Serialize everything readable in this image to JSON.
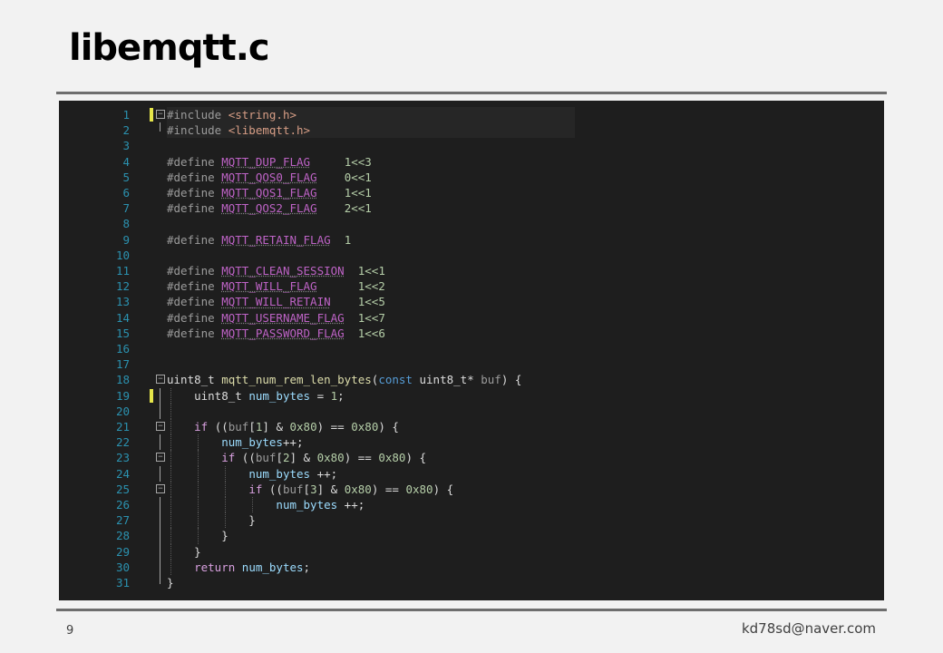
{
  "slide": {
    "title": "libemqtt.c",
    "page_number": "9",
    "email": "kd78sd@naver.com"
  },
  "editor": {
    "lines": [
      {
        "n": "1",
        "mark": "yellow",
        "fold": "minus",
        "hl": true,
        "tokens": [
          [
            "pp",
            "#include "
          ],
          [
            "str",
            "<string.h>"
          ]
        ]
      },
      {
        "n": "2",
        "mark": "",
        "fold": "end",
        "hl": true,
        "tokens": [
          [
            "pp",
            "#include "
          ],
          [
            "str",
            "<libemqtt.h>"
          ]
        ]
      },
      {
        "n": "3",
        "tokens": []
      },
      {
        "n": "4",
        "tokens": [
          [
            "pp",
            "#define "
          ],
          [
            "mac",
            "MQTT_DUP_FLAG"
          ],
          [
            "typ",
            "     "
          ],
          [
            "num",
            "1<<3"
          ]
        ]
      },
      {
        "n": "5",
        "tokens": [
          [
            "pp",
            "#define "
          ],
          [
            "mac",
            "MQTT_QOS0_FLAG"
          ],
          [
            "typ",
            "    "
          ],
          [
            "num",
            "0<<1"
          ]
        ]
      },
      {
        "n": "6",
        "tokens": [
          [
            "pp",
            "#define "
          ],
          [
            "mac",
            "MQTT_QOS1_FLAG"
          ],
          [
            "typ",
            "    "
          ],
          [
            "num",
            "1<<1"
          ]
        ]
      },
      {
        "n": "7",
        "tokens": [
          [
            "pp",
            "#define "
          ],
          [
            "mac",
            "MQTT_QOS2_FLAG"
          ],
          [
            "typ",
            "    "
          ],
          [
            "num",
            "2<<1"
          ]
        ]
      },
      {
        "n": "8",
        "tokens": []
      },
      {
        "n": "9",
        "tokens": [
          [
            "pp",
            "#define "
          ],
          [
            "mac",
            "MQTT_RETAIN_FLAG"
          ],
          [
            "typ",
            "  "
          ],
          [
            "num",
            "1"
          ]
        ]
      },
      {
        "n": "10",
        "tokens": []
      },
      {
        "n": "11",
        "tokens": [
          [
            "pp",
            "#define "
          ],
          [
            "mac",
            "MQTT_CLEAN_SESSION"
          ],
          [
            "typ",
            "  "
          ],
          [
            "num",
            "1<<1"
          ]
        ]
      },
      {
        "n": "12",
        "tokens": [
          [
            "pp",
            "#define "
          ],
          [
            "mac",
            "MQTT_WILL_FLAG"
          ],
          [
            "typ",
            "      "
          ],
          [
            "num",
            "1<<2"
          ]
        ]
      },
      {
        "n": "13",
        "tokens": [
          [
            "pp",
            "#define "
          ],
          [
            "mac",
            "MQTT_WILL_RETAIN"
          ],
          [
            "typ",
            "    "
          ],
          [
            "num",
            "1<<5"
          ]
        ]
      },
      {
        "n": "14",
        "tokens": [
          [
            "pp",
            "#define "
          ],
          [
            "mac",
            "MQTT_USERNAME_FLAG"
          ],
          [
            "typ",
            "  "
          ],
          [
            "num",
            "1<<7"
          ]
        ]
      },
      {
        "n": "15",
        "tokens": [
          [
            "pp",
            "#define "
          ],
          [
            "mac",
            "MQTT_PASSWORD_FLAG"
          ],
          [
            "typ",
            "  "
          ],
          [
            "num",
            "1<<6"
          ]
        ]
      },
      {
        "n": "16",
        "tokens": []
      },
      {
        "n": "17",
        "tokens": []
      },
      {
        "n": "18",
        "fold": "minus",
        "tokens": [
          [
            "typ",
            "uint8_t "
          ],
          [
            "fn",
            "mqtt_num_rem_len_bytes"
          ],
          [
            "typ",
            "("
          ],
          [
            "kw",
            "const"
          ],
          [
            "typ",
            " uint8_t"
          ],
          [
            "typ",
            "* "
          ],
          [
            "pp",
            "buf"
          ],
          [
            "typ",
            ") {"
          ]
        ]
      },
      {
        "n": "19",
        "mark": "yellow",
        "guide": true,
        "indent": 1,
        "tokens": [
          [
            "typ",
            "    uint8_t "
          ],
          [
            "var",
            "num_bytes"
          ],
          [
            "typ",
            " = "
          ],
          [
            "num",
            "1"
          ],
          [
            "typ",
            ";"
          ]
        ]
      },
      {
        "n": "20",
        "guide": true,
        "indent": 1,
        "tokens": []
      },
      {
        "n": "21",
        "fold": "minus",
        "indent": 1,
        "tokens": [
          [
            "typ",
            "    "
          ],
          [
            "kwc",
            "if"
          ],
          [
            "typ",
            " (("
          ],
          [
            "pp",
            "buf"
          ],
          [
            "typ",
            "["
          ],
          [
            "num",
            "1"
          ],
          [
            "typ",
            "] & "
          ],
          [
            "num",
            "0x80"
          ],
          [
            "typ",
            ") == "
          ],
          [
            "num",
            "0x80"
          ],
          [
            "typ",
            ") {"
          ]
        ]
      },
      {
        "n": "22",
        "guide": true,
        "indent": 2,
        "tokens": [
          [
            "typ",
            "        "
          ],
          [
            "var",
            "num_bytes"
          ],
          [
            "typ",
            "++;"
          ]
        ]
      },
      {
        "n": "23",
        "fold": "minus",
        "indent": 2,
        "tokens": [
          [
            "typ",
            "        "
          ],
          [
            "kwc",
            "if"
          ],
          [
            "typ",
            " (("
          ],
          [
            "pp",
            "buf"
          ],
          [
            "typ",
            "["
          ],
          [
            "num",
            "2"
          ],
          [
            "typ",
            "] & "
          ],
          [
            "num",
            "0x80"
          ],
          [
            "typ",
            ") == "
          ],
          [
            "num",
            "0x80"
          ],
          [
            "typ",
            ") {"
          ]
        ]
      },
      {
        "n": "24",
        "guide": true,
        "indent": 3,
        "tokens": [
          [
            "typ",
            "            "
          ],
          [
            "var",
            "num_bytes"
          ],
          [
            "typ",
            " ++;"
          ]
        ]
      },
      {
        "n": "25",
        "fold": "minus",
        "indent": 3,
        "tokens": [
          [
            "typ",
            "            "
          ],
          [
            "kwc",
            "if"
          ],
          [
            "typ",
            " (("
          ],
          [
            "pp",
            "buf"
          ],
          [
            "typ",
            "["
          ],
          [
            "num",
            "3"
          ],
          [
            "typ",
            "] & "
          ],
          [
            "num",
            "0x80"
          ],
          [
            "typ",
            ") == "
          ],
          [
            "num",
            "0x80"
          ],
          [
            "typ",
            ") {"
          ]
        ]
      },
      {
        "n": "26",
        "guide": true,
        "indent": 4,
        "tokens": [
          [
            "typ",
            "                "
          ],
          [
            "var",
            "num_bytes"
          ],
          [
            "typ",
            " ++;"
          ]
        ]
      },
      {
        "n": "27",
        "guide": true,
        "indent": 3,
        "tokens": [
          [
            "typ",
            "            }"
          ]
        ]
      },
      {
        "n": "28",
        "guide": true,
        "indent": 2,
        "tokens": [
          [
            "typ",
            "        }"
          ]
        ]
      },
      {
        "n": "29",
        "guide": true,
        "indent": 1,
        "tokens": [
          [
            "typ",
            "    }"
          ]
        ]
      },
      {
        "n": "30",
        "guide": true,
        "indent": 1,
        "tokens": [
          [
            "typ",
            "    "
          ],
          [
            "kwc",
            "return"
          ],
          [
            "typ",
            " "
          ],
          [
            "var",
            "num_bytes"
          ],
          [
            "typ",
            ";"
          ]
        ]
      },
      {
        "n": "31",
        "fold": "end",
        "tokens": [
          [
            "typ",
            "}"
          ]
        ]
      }
    ]
  }
}
